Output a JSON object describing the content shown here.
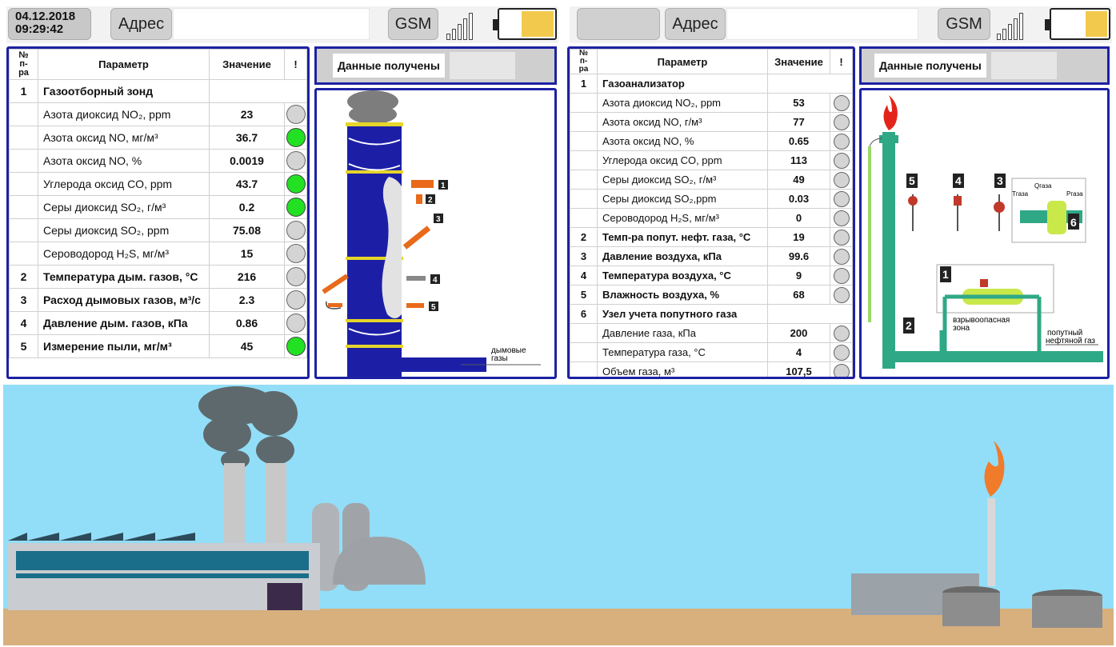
{
  "left": {
    "datetime": {
      "date": "04.12.2018",
      "time": "09:29:42"
    },
    "address_button": "Адрес",
    "gsm_button": "GSM",
    "battery_level": 0.6,
    "status": {
      "label": "Данные получены"
    },
    "table": {
      "headers": {
        "num": "№\nп-ра",
        "param": "Параметр",
        "value": "Значение",
        "flag": "!"
      },
      "rows": [
        {
          "num": "1",
          "param": "Газоотборный зонд",
          "value": "",
          "bold": true,
          "led": "none"
        },
        {
          "num": "",
          "param": "Азота диоксид NO₂, ppm",
          "value": "23",
          "bold": false,
          "led": "gray"
        },
        {
          "num": "",
          "param": "Азота оксид NO, мг/м³",
          "value": "36.7",
          "bold": false,
          "led": "green"
        },
        {
          "num": "",
          "param": "Азота оксид NO, %",
          "value": "0.0019",
          "bold": false,
          "led": "gray"
        },
        {
          "num": "",
          "param": "Углерода оксид CO, ppm",
          "value": "43.7",
          "bold": false,
          "led": "green"
        },
        {
          "num": "",
          "param": "Серы диоксид SO₂, г/м³",
          "value": "0.2",
          "bold": false,
          "led": "green"
        },
        {
          "num": "",
          "param": "Серы диоксид SO₂, ppm",
          "value": "75.08",
          "bold": false,
          "led": "gray"
        },
        {
          "num": "",
          "param": "Сероводород H₂S, мг/м³",
          "value": "15",
          "bold": false,
          "led": "gray"
        },
        {
          "num": "2",
          "param": "Температура дым. газов, °С",
          "value": "216",
          "bold": true,
          "led": "gray"
        },
        {
          "num": "3",
          "param": "Расход дымовых газов, м³/с",
          "value": "2.3",
          "bold": true,
          "led": "gray"
        },
        {
          "num": "4",
          "param": "Давление дым. газов, кПа",
          "value": "0.86",
          "bold": true,
          "led": "gray"
        },
        {
          "num": "5",
          "param": "Измерение пыли, мг/м³",
          "value": "45",
          "bold": true,
          "led": "green"
        }
      ]
    },
    "diagram": {
      "flue_label_1": "дымовые",
      "flue_label_2": "газы",
      "tags": [
        "1",
        "2",
        "3",
        "4",
        "5"
      ]
    }
  },
  "right": {
    "address_button": "Адрес",
    "gsm_button": "GSM",
    "battery_level": 0.4,
    "status": {
      "label": "Данные получены"
    },
    "table": {
      "headers": {
        "num": "№\nп-ра",
        "param": "Параметр",
        "value": "Значение",
        "flag": "!"
      },
      "rows": [
        {
          "num": "1",
          "param": "Газоанализатор",
          "value": "",
          "bold": true,
          "led": "none"
        },
        {
          "num": "",
          "param": "Азота диоксид NO₂, ppm",
          "value": "53",
          "bold": false,
          "led": "gray"
        },
        {
          "num": "",
          "param": "Азота оксид NO, г/м³",
          "value": "77",
          "bold": false,
          "led": "gray"
        },
        {
          "num": "",
          "param": "Азота оксид NO, %",
          "value": "0.65",
          "bold": false,
          "led": "gray"
        },
        {
          "num": "",
          "param": "Углерода оксид CO, ppm",
          "value": "113",
          "bold": false,
          "led": "gray"
        },
        {
          "num": "",
          "param": "Серы диоксид SO₂, г/м³",
          "value": "49",
          "bold": false,
          "led": "gray"
        },
        {
          "num": "",
          "param": "Серы диоксид SO₂,ppm",
          "value": "0.03",
          "bold": false,
          "led": "gray"
        },
        {
          "num": "",
          "param": "Сероводород H₂S, мг/м³",
          "value": "0",
          "bold": false,
          "led": "gray"
        },
        {
          "num": "2",
          "param": "Темп-ра попут. нефт. газа, °С",
          "value": "19",
          "bold": true,
          "led": "gray"
        },
        {
          "num": "3",
          "param": "Давление воздуха, кПа",
          "value": "99.6",
          "bold": true,
          "led": "gray"
        },
        {
          "num": "4",
          "param": "Температура воздуха, °С",
          "value": "9",
          "bold": true,
          "led": "gray"
        },
        {
          "num": "5",
          "param": "Влажность воздуха, %",
          "value": "68",
          "bold": true,
          "led": "gray"
        },
        {
          "num": "6",
          "param": "Узел учета попутного газа",
          "value": "",
          "bold": true,
          "led": "none"
        },
        {
          "num": "",
          "param": "Давление газа, кПа",
          "value": "200",
          "bold": false,
          "led": "gray"
        },
        {
          "num": "",
          "param": "Температура газа, °С",
          "value": "4",
          "bold": false,
          "led": "gray"
        },
        {
          "num": "",
          "param": "Объем газа, м³",
          "value": "107,5",
          "bold": false,
          "led": "gray"
        }
      ]
    },
    "diagram": {
      "label_explosive_1": "взрывоопасная",
      "label_explosive_2": "зона",
      "label_gas_1": "попутный",
      "label_gas_2": "нефтяной газ",
      "label_tgas": "Tгаза",
      "label_qgas": "Qгаза",
      "label_pgas": "Pгаза",
      "tags": [
        "1",
        "2",
        "3",
        "4",
        "5",
        "6"
      ]
    }
  }
}
